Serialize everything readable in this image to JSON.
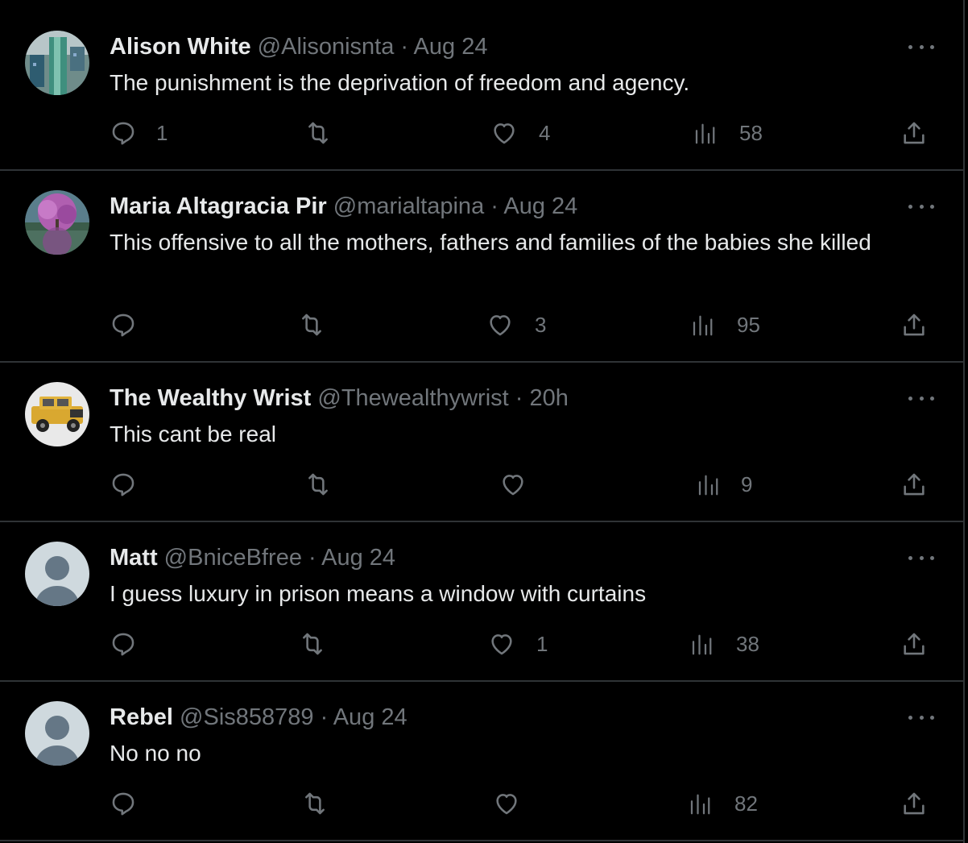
{
  "replies": [
    {
      "name": "Alison White",
      "handle": "@Alisonisnta",
      "time": "Aug 24",
      "text": "The punishment is the deprivation of freedom and agency.",
      "stats": {
        "replies": "1",
        "reposts": "",
        "likes": "4",
        "views": "58"
      },
      "avatar": "building-photo"
    },
    {
      "name": "Maria Altagracia Pir",
      "handle": "@marialtapina",
      "time": "Aug 24",
      "text": "This offensive to all the mothers, fathers and families of the babies she killed",
      "stats": {
        "replies": "",
        "reposts": "",
        "likes": "3",
        "views": "95"
      },
      "avatar": "purple-tree-photo"
    },
    {
      "name": "The Wealthy Wrist",
      "handle": "@Thewealthywrist",
      "time": "20h",
      "text": "This cant be real",
      "stats": {
        "replies": "",
        "reposts": "",
        "likes": "",
        "views": "9"
      },
      "avatar": "yellow-jeep-photo"
    },
    {
      "name": "Matt",
      "handle": "@BniceBfree",
      "time": "Aug 24",
      "text": "I guess luxury in prison means a window with curtains",
      "stats": {
        "replies": "",
        "reposts": "",
        "likes": "1",
        "views": "38"
      },
      "avatar": "default-avatar"
    },
    {
      "name": "Rebel",
      "handle": "@Sis858789",
      "time": "Aug 24",
      "text": "No no no",
      "stats": {
        "replies": "",
        "reposts": "",
        "likes": "",
        "views": "82"
      },
      "avatar": "default-avatar"
    }
  ],
  "separator": " · ",
  "colors": {
    "background": "#000000",
    "text": "#e7e9ea",
    "secondary": "#71767b",
    "divider": "#2f3336"
  }
}
